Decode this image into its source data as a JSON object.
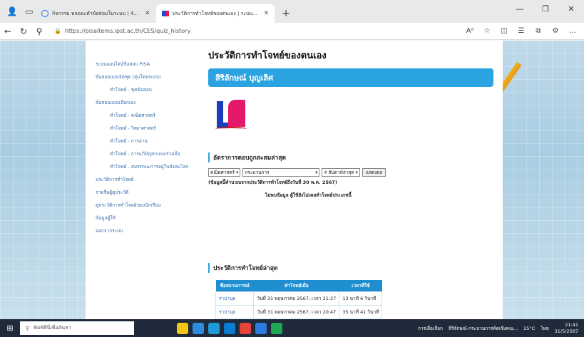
{
  "browser": {
    "tabs": [
      {
        "label": "กิจกรรม หลออะทำข้อสอบในระบบ | 4...",
        "active": false
      },
      {
        "label": "ประวัติการทำโจทย์ของตนเอง | ระบบ...",
        "active": true
      }
    ],
    "url": "https://pisaitems.ipst.ac.th/CES/quiz_history"
  },
  "sidebar": {
    "items": [
      {
        "label": "ระบบออนไลน์ข้อสอบ PISA",
        "sub": false
      },
      {
        "label": "ข้อสอบแบบจัดชุด (สุ่มโดยระบบ)",
        "sub": false
      },
      {
        "label": "ทำโจทย์ - ชุดข้อสอบ",
        "sub": true
      },
      {
        "label": "ข้อสอบแบบเลือกเอง",
        "sub": false
      },
      {
        "label": "ทำโจทย์ - คณิตศาสตร์",
        "sub": true
      },
      {
        "label": "ทำโจทย์ - วิทยาศาสตร์",
        "sub": true
      },
      {
        "label": "ทำโจทย์ - การอ่าน",
        "sub": true
      },
      {
        "label": "ทำโจทย์ - การแก้ปัญหาแบบร่วมมือ",
        "sub": true
      },
      {
        "label": "ทำโจทย์ - สมรรถนะการอยู่ในสังคมโลก",
        "sub": true
      },
      {
        "label": "ประวัติการทำโจทย์",
        "sub": false
      },
      {
        "label": "รายชื่อผู้ดูประวัติ",
        "sub": false
      },
      {
        "label": "ดูประวัติการทำโจทย์ของนักเรียน",
        "sub": false
      },
      {
        "label": "ข้อมูลผู้ใช้",
        "sub": false
      },
      {
        "label": "ออกจากระบบ",
        "sub": false
      }
    ]
  },
  "main": {
    "title": "ประวัติการทำโจทย์ของตนเอง",
    "user_name": "สิริลักษณ์ บุญเลิศ",
    "accuracy_heading": "อัตราการตอบถูกสะสมล่าสุด",
    "filters": {
      "subject": "คณิตศาสตร์",
      "process": "กระบวนการ",
      "period": "4 สัปดาห์ล่าสุด",
      "show_button": "แสดงผล"
    },
    "note": "(ข้อมูลนี้คำนวณจากประวัติการทำโจทย์ถึงวันที่ 30 พ.ค. 2567)",
    "no_data": "ไม่พบข้อมูล ผู้ใช้ยังไม่เคยทำโจทย์ประเภทนี้",
    "recent_heading": "ประวัติการทำโจทย์ล่าสุด",
    "table": {
      "headers": [
        "ชื่อสถานการณ์",
        "ทำโจทย์เมื่อ",
        "เวลาที่ใช้"
      ],
      "rows": [
        [
          "ราปานุย",
          "วันที่ 31 พฤษภาคม 2567, เวลา 21:27",
          "13 นาที 6 วินาที"
        ],
        [
          "ราปานุย",
          "วันที่ 31 พฤษภาคม 2567, เวลา 20:47",
          "35 นาที 41 วินาที"
        ]
      ]
    }
  },
  "taskbar": {
    "search_placeholder": "พิมพ์ที่นี่เพื่อค้นหา",
    "task_label_1": "การเผื่อเลือก",
    "task_label_2": "สิริลักษณ์-กระบวนการคิดเชิงคณ...",
    "temperature": "25°C",
    "lang": "ไทย",
    "time": "21:41",
    "date": "31/5/2567"
  }
}
